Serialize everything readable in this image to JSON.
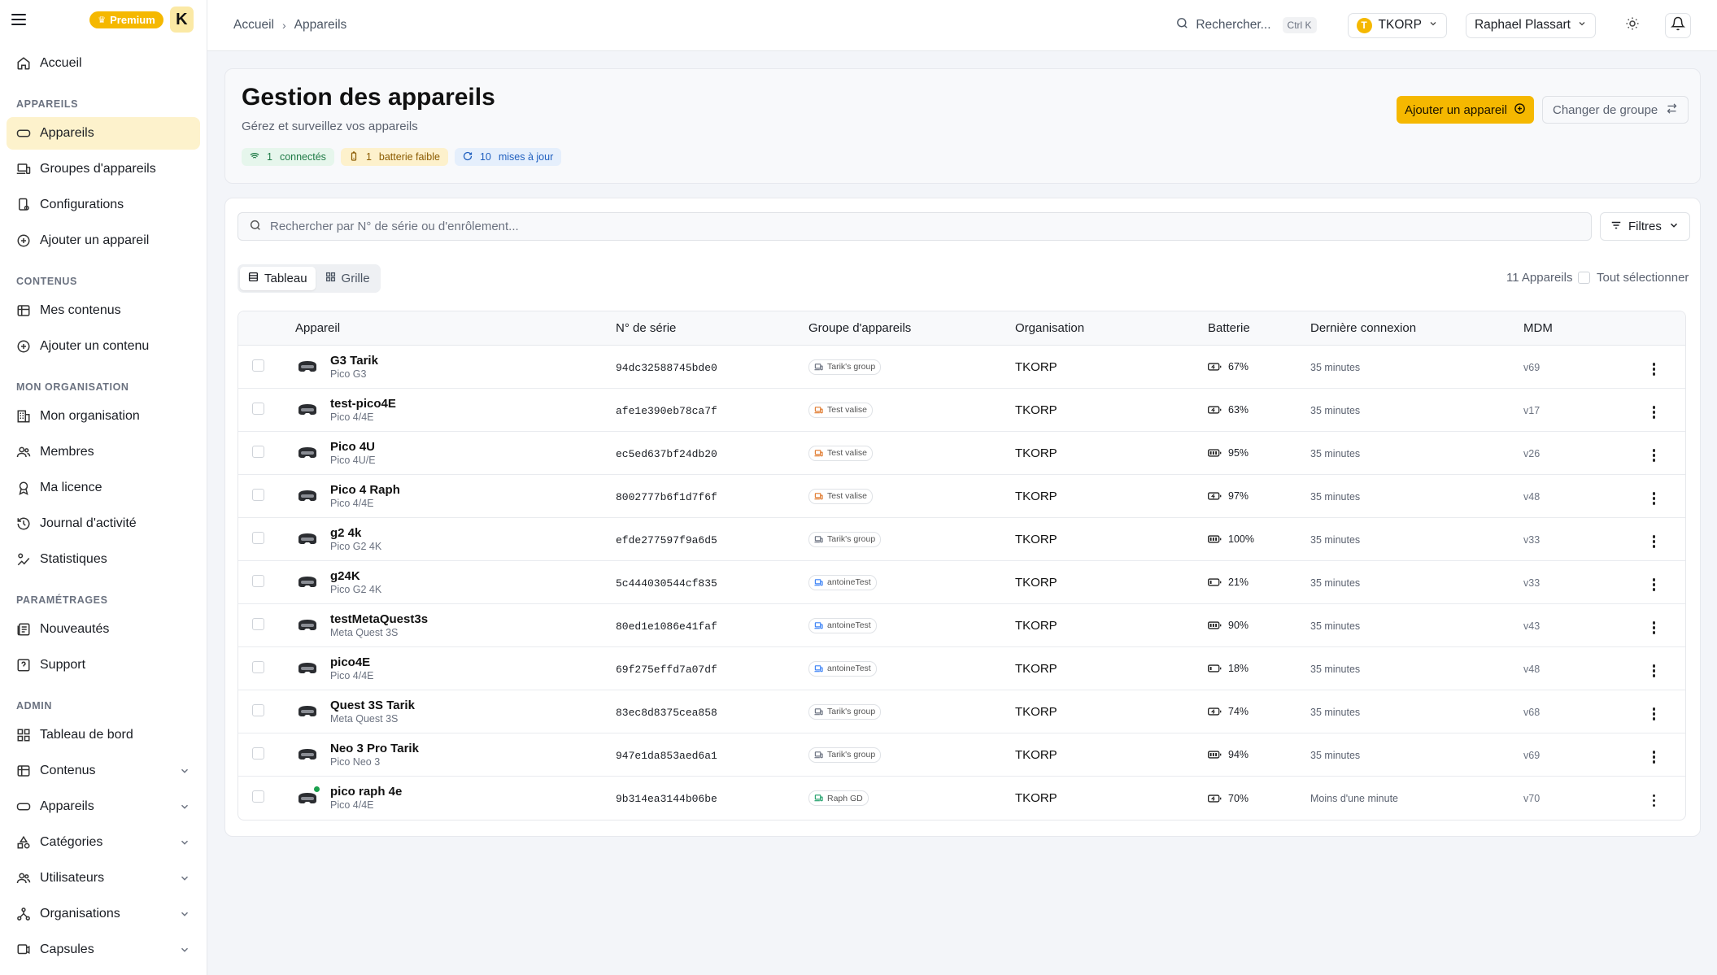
{
  "sidebar": {
    "premium_label": "Premium",
    "logo_letter": "K",
    "home": "Accueil",
    "sections": {
      "devices": "APPAREILS",
      "contents": "CONTENUS",
      "org": "MON ORGANISATION",
      "settings": "PARAMÉTRAGES",
      "admin": "ADMIN"
    },
    "items": {
      "appareils": "Appareils",
      "groupes": "Groupes d'appareils",
      "configurations": "Configurations",
      "ajouter_appareil": "Ajouter un appareil",
      "mes_contenus": "Mes contenus",
      "ajouter_contenu": "Ajouter un contenu",
      "mon_organisation": "Mon organisation",
      "membres": "Membres",
      "ma_licence": "Ma licence",
      "journal": "Journal d'activité",
      "statistiques": "Statistiques",
      "nouveautes": "Nouveautés",
      "support": "Support",
      "tableau_de_bord": "Tableau de bord",
      "admin_contenus": "Contenus",
      "admin_appareils": "Appareils",
      "categories": "Catégories",
      "utilisateurs": "Utilisateurs",
      "organisations": "Organisations",
      "capsules": "Capsules"
    }
  },
  "topbar": {
    "breadcrumb": [
      "Accueil",
      "Appareils"
    ],
    "search_label": "Rechercher...",
    "search_shortcut": "Ctrl K",
    "org_initial": "T",
    "org_name": "TKORP",
    "user_name": "Raphael Plassart"
  },
  "header": {
    "title": "Gestion des appareils",
    "subtitle": "Gérez et surveillez vos appareils",
    "chips": {
      "connected_count": "1",
      "connected_label": "connectés",
      "battery_count": "1",
      "battery_label": "batterie faible",
      "updates_count": "10",
      "updates_label": "mises à jour"
    },
    "add_button": "Ajouter un appareil",
    "change_group_button": "Changer de groupe"
  },
  "list": {
    "search_placeholder": "Rechercher par N° de série ou d'enrôlement...",
    "filters_label": "Filtres",
    "view_table": "Tableau",
    "view_grid": "Grille",
    "count_label": "11 Appareils",
    "select_all_label": "Tout sélectionner",
    "columns": [
      "Appareil",
      "N° de série",
      "Groupe d'appareils",
      "Organisation",
      "Batterie",
      "Dernière connexion",
      "MDM"
    ],
    "rows": [
      {
        "name": "G3 Tarik",
        "model": "Pico G3",
        "serial": "94dc32588745bde0",
        "group": "Tarik's group",
        "group_color": "#6b7280",
        "org": "TKORP",
        "battery": "67%",
        "battery_charging": true,
        "last": "35 minutes",
        "mdm": "v69",
        "online": false
      },
      {
        "name": "test-pico4E",
        "model": "Pico 4/4E",
        "serial": "afe1e390eb78ca7f",
        "group": "Test valise",
        "group_color": "#e07a2e",
        "org": "TKORP",
        "battery": "63%",
        "battery_charging": true,
        "last": "35 minutes",
        "mdm": "v17",
        "online": false
      },
      {
        "name": "Pico 4U",
        "model": "Pico 4U/E",
        "serial": "ec5ed637bf24db20",
        "group": "Test valise",
        "group_color": "#e07a2e",
        "org": "TKORP",
        "battery": "95%",
        "battery_charging": false,
        "last": "35 minutes",
        "mdm": "v26",
        "online": false
      },
      {
        "name": "Pico 4 Raph",
        "model": "Pico 4/4E",
        "serial": "8002777b6f1d7f6f",
        "group": "Test valise",
        "group_color": "#e07a2e",
        "org": "TKORP",
        "battery": "97%",
        "battery_charging": true,
        "last": "35 minutes",
        "mdm": "v48",
        "online": false
      },
      {
        "name": "g2 4k",
        "model": "Pico G2 4K",
        "serial": "efde277597f9a6d5",
        "group": "Tarik's group",
        "group_color": "#6b7280",
        "org": "TKORP",
        "battery": "100%",
        "battery_charging": false,
        "last": "35 minutes",
        "mdm": "v33",
        "online": false
      },
      {
        "name": "g24K",
        "model": "Pico G2 4K",
        "serial": "5c444030544cf835",
        "group": "antoineTest",
        "group_color": "#3b82f6",
        "org": "TKORP",
        "battery": "21%",
        "battery_charging": false,
        "last": "35 minutes",
        "mdm": "v33",
        "online": false
      },
      {
        "name": "testMetaQuest3s",
        "model": "Meta Quest 3S",
        "serial": "80ed1e1086e41faf",
        "group": "antoineTest",
        "group_color": "#3b82f6",
        "org": "TKORP",
        "battery": "90%",
        "battery_charging": false,
        "last": "35 minutes",
        "mdm": "v43",
        "online": false
      },
      {
        "name": "pico4E",
        "model": "Pico 4/4E",
        "serial": "69f275effd7a07df",
        "group": "antoineTest",
        "group_color": "#3b82f6",
        "org": "TKORP",
        "battery": "18%",
        "battery_charging": false,
        "last": "35 minutes",
        "mdm": "v48",
        "online": false
      },
      {
        "name": "Quest 3S Tarik",
        "model": "Meta Quest 3S",
        "serial": "83ec8d8375cea858",
        "group": "Tarik's group",
        "group_color": "#6b7280",
        "org": "TKORP",
        "battery": "74%",
        "battery_charging": true,
        "last": "35 minutes",
        "mdm": "v68",
        "online": false
      },
      {
        "name": "Neo 3 Pro Tarik",
        "model": "Pico Neo 3",
        "serial": "947e1da853aed6a1",
        "group": "Tarik's group",
        "group_color": "#6b7280",
        "org": "TKORP",
        "battery": "94%",
        "battery_charging": false,
        "last": "35 minutes",
        "mdm": "v69",
        "online": false
      },
      {
        "name": "pico raph 4e",
        "model": "Pico 4/4E",
        "serial": "9b314ea3144b06be",
        "group": "Raph GD",
        "group_color": "#22a06b",
        "org": "TKORP",
        "battery": "70%",
        "battery_charging": true,
        "last": "Moins d'une minute",
        "mdm": "v70",
        "online": true
      }
    ]
  },
  "colors": {
    "accent": "#f5b800",
    "active_nav_bg": "#fdf2cc",
    "online": "#1aa04d"
  }
}
